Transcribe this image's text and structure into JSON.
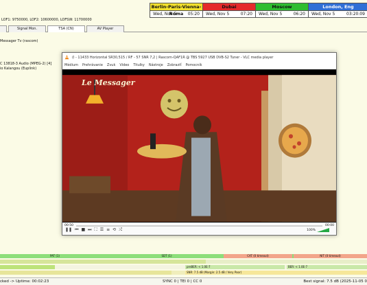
{
  "clocks": [
    {
      "city": "Berlin-Paris-Vienna-Roma",
      "date": "Wed, Nov 5",
      "time": "05:20",
      "color": "#f2e02b"
    },
    {
      "city": "Dubai",
      "date": "Wed, Nov 5",
      "time": "07:20",
      "color": "#e52a2a"
    },
    {
      "city": "Moscow",
      "date": "Wed, Nov 5",
      "time": "06:20",
      "color": "#2fbd2f"
    },
    {
      "city": "London, Eng",
      "date": "Wed, Nov 5",
      "time": "03:20:09",
      "color": "#2f6fd6"
    }
  ],
  "info_line": "LOF1: 9750000, LOF2: 10600000, LOFSW: 11700000",
  "tabs": [
    "",
    "Signal Mon.",
    "TSA (CN)",
    "AV Player"
  ],
  "active_tab": "TSA (CN)",
  "left_info": {
    "channel": "Messager Tv (rascom)",
    "audio": "C 13818-3 Audio (MPEG-2) [4]",
    "audio2": "io Kalangou (Euplink)"
  },
  "vlc": {
    "title": "(I - 11433 Horizontal SR30,515 / RF - 57 SNR 7,2 | Rascom-QAF1R @ TBS 5927 USB DVB-S2 Tuner - VLC media player",
    "menu": [
      "Médium",
      "Prehrávanie",
      "Zvuk",
      "Video",
      "Titulky",
      "Nástroje",
      "Zobraziť",
      "Pomocník"
    ],
    "time_elapsed": "00:50",
    "time_total": "00:00",
    "overlay_logo": "Le Messager",
    "volume_label": "100%",
    "colors": {
      "accent": "#2a7fd4"
    }
  },
  "signal_rows": {
    "row1": [
      "PAT (1)",
      "SDT (1)",
      "CAT (0 timeout)",
      "NIT (0 timeout)"
    ],
    "pre_ber": "preBER: < 1.0E-7",
    "ber": "BER: < 1.0E-7",
    "snr": "SNR: 7.5 dB (Margin: 2.5 dB / Very Poor)"
  },
  "status": {
    "left": "cked -> Uptime: 00:02:23",
    "center": "SYNC 0 | TEI 0 | CC 0",
    "right": "Best signal: 7.5 dB (2025-11-05 0"
  }
}
